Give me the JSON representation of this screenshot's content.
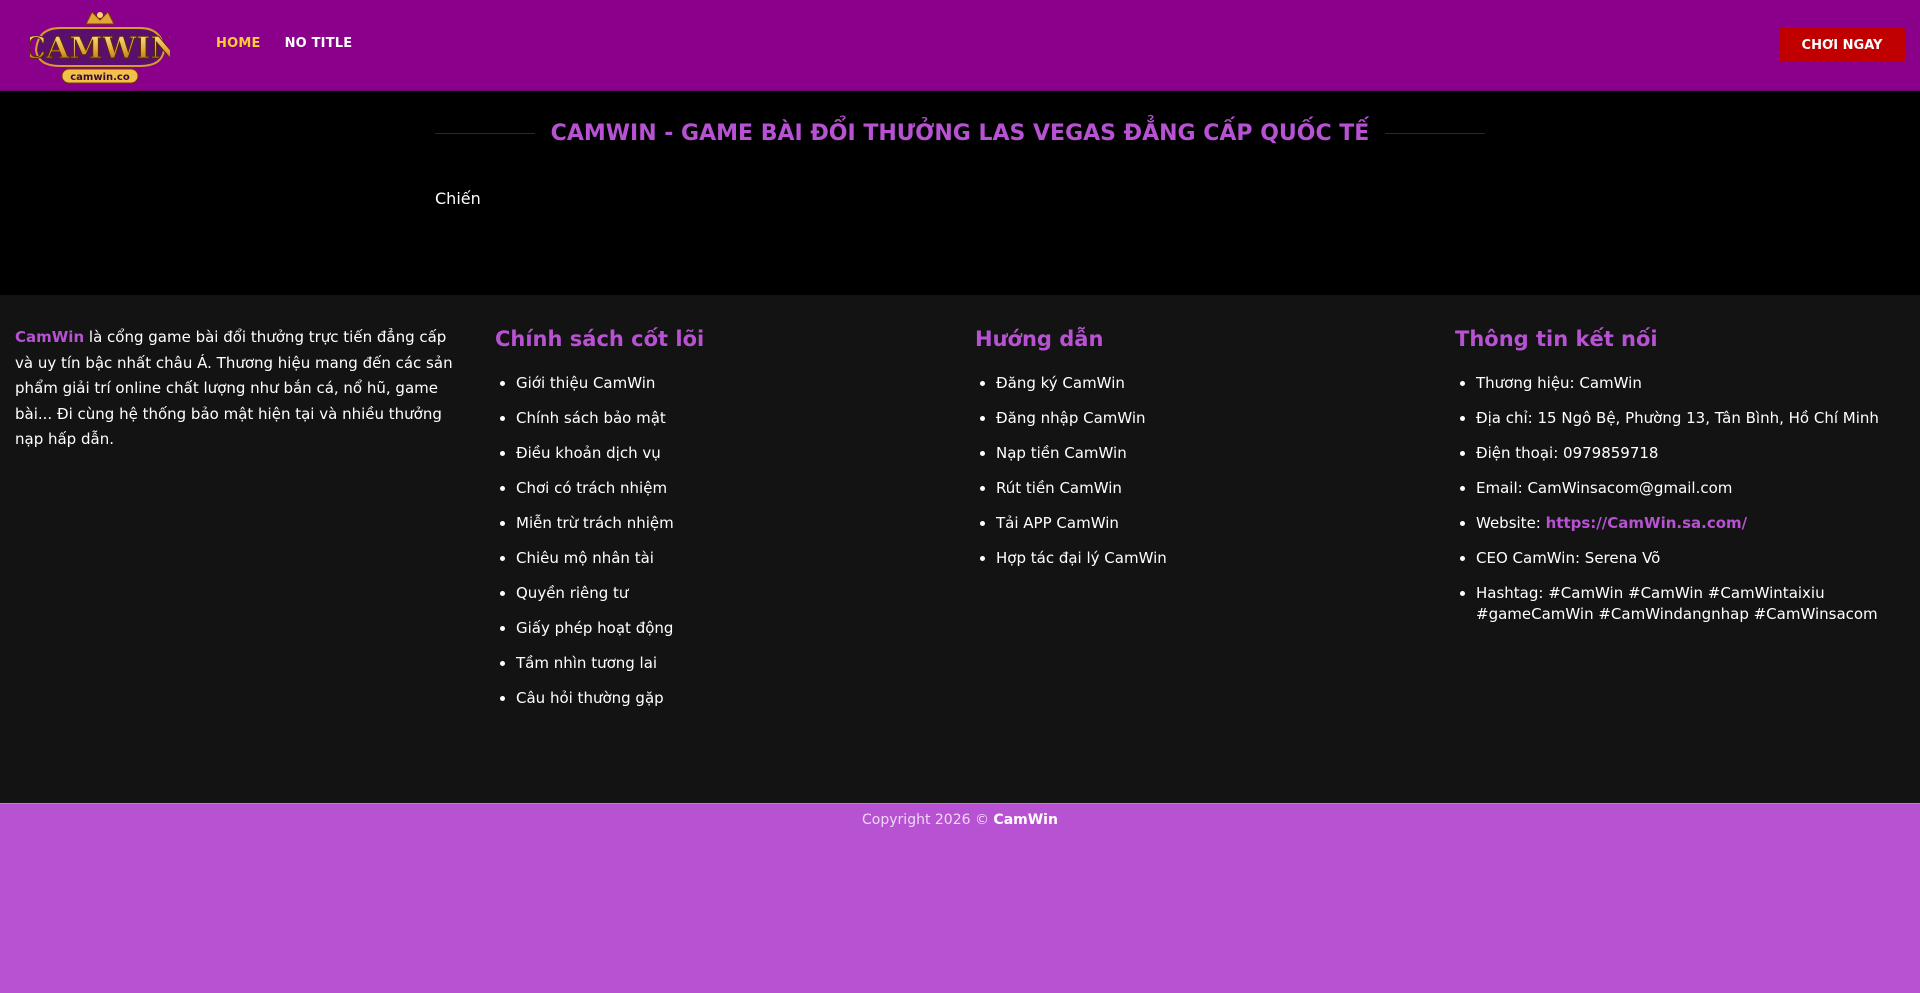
{
  "header": {
    "logo_text": "CAMWIN",
    "logo_sub": "camwin.co",
    "nav": [
      {
        "label": "HOME"
      },
      {
        "label": "NO TITLE"
      }
    ],
    "cta_label": "CHƠI NGAY",
    "colors": {
      "bg": "#8b008b",
      "active": "#ffcc33",
      "cta": "#c00000"
    }
  },
  "main": {
    "title": "CAMWIN - GAME BÀI ĐỔI THƯỞNG LAS VEGAS ĐẲNG CẤP QUỐC TẾ",
    "body": "Chiến"
  },
  "footer": {
    "about": {
      "brand": "CamWin",
      "text": " là cổng game bài đổi thưởng trực tiến đẳng cấp và uy tín bậc nhất châu Á. Thương hiệu mang đến các sản phẩm giải trí online chất lượng như bắn cá, nổ hũ, game bài... Đi cùng hệ thống bảo mật hiện tại và nhiều thưởng nạp hấp dẫn."
    },
    "policy": {
      "title": "Chính sách cốt lõi",
      "items": [
        "Giới thiệu CamWin",
        "Chính sách bảo mật",
        "Điều khoản dịch vụ",
        "Chơi có trách nhiệm",
        "Miễn trừ trách nhiệm",
        "Chiêu mộ nhân tài",
        "Quyền riêng tư",
        "Giấy phép hoạt động",
        "Tầm nhìn tương lai",
        "Câu hỏi thường gặp"
      ]
    },
    "guide": {
      "title": "Hướng dẫn",
      "items": [
        "Đăng ký CamWin",
        "Đăng nhập CamWin",
        "Nạp tiền CamWin",
        "Rút tiền CamWin",
        "Tải APP CamWin",
        "Hợp tác đại lý CamWin"
      ]
    },
    "contact": {
      "title": "Thông tin kết nối",
      "brand": "Thương hiệu: CamWin",
      "address": "Địa chỉ: 15 Ngô Bệ, Phường 13, Tân Bình, Hồ Chí Minh",
      "phone": "Điện thoại: 0979859718",
      "email": "Email: CamWinsacom@gmail.com",
      "website_label": "Website: ",
      "website_url": "https://CamWin.sa.com/",
      "ceo": "CEO CamWin: Serena Võ",
      "hashtag": "Hashtag: #CamWin #CamWin #CamWintaixiu #gameCamWin #CamWindangnhap #CamWinsacom"
    }
  },
  "copyright": {
    "text": "Copyright 2026 © ",
    "brand": "CamWin"
  }
}
